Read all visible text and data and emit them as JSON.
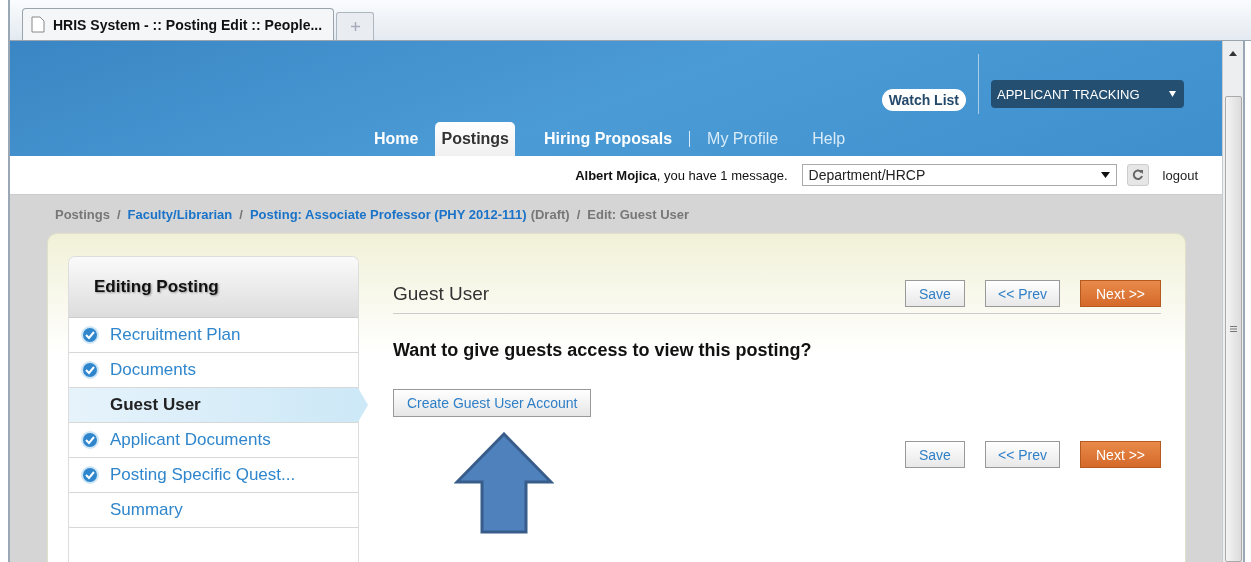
{
  "browser": {
    "tab_title": "HRIS System - :: Posting Edit :: People..."
  },
  "header": {
    "watch_list": "Watch List",
    "product_select": "APPLICANT TRACKING",
    "nav": [
      {
        "label": "Home",
        "kind": "primary",
        "selected": false
      },
      {
        "label": "Postings",
        "kind": "primary",
        "selected": true
      },
      {
        "label": "Hiring Proposals",
        "kind": "primary",
        "selected": false
      },
      {
        "label": "My Profile",
        "kind": "secondary",
        "selected": false
      },
      {
        "label": "Help",
        "kind": "secondary",
        "selected": false
      }
    ]
  },
  "user_bar": {
    "greeting": "**Albert Mojica**, you have 1 message.",
    "department_select": "Department/HRCP",
    "logout": "logout"
  },
  "breadcrumbs": [
    {
      "label": "Postings",
      "kind": "plain"
    },
    {
      "label": "/",
      "kind": "separator"
    },
    {
      "label": "Faculty/Librarian",
      "kind": "link"
    },
    {
      "label": "/",
      "kind": "separator"
    },
    {
      "label": "Posting: Associate Professor (PHY 2012-111)",
      "kind": "link"
    },
    {
      "label": "(Draft)",
      "kind": "plain"
    },
    {
      "label": "/",
      "kind": "separator"
    },
    {
      "label": "Edit: Guest User",
      "kind": "plain"
    }
  ],
  "sidebar": {
    "title": "Editing Posting",
    "items": [
      {
        "label": "Recruitment Plan",
        "done": true,
        "selected": false
      },
      {
        "label": "Documents",
        "done": true,
        "selected": false
      },
      {
        "label": "Guest User",
        "done": false,
        "selected": true
      },
      {
        "label": "Applicant Documents",
        "done": true,
        "selected": false
      },
      {
        "label": "Posting Specific Quest...",
        "done": true,
        "selected": false
      },
      {
        "label": "Summary",
        "done": false,
        "selected": false
      }
    ]
  },
  "content": {
    "title": "Guest User",
    "actions_top": [
      {
        "label": "Save",
        "kind": "plain"
      },
      {
        "label": "<< Prev",
        "kind": "plain"
      },
      {
        "label": "Next >>",
        "kind": "primary"
      }
    ],
    "question": "Want to give guests access to view this posting?",
    "create_button": "Create Guest User Account",
    "actions_bottom": [
      {
        "label": "Save",
        "kind": "plain"
      },
      {
        "label": "<< Prev",
        "kind": "plain"
      },
      {
        "label": "Next >>",
        "kind": "primary"
      }
    ]
  }
}
